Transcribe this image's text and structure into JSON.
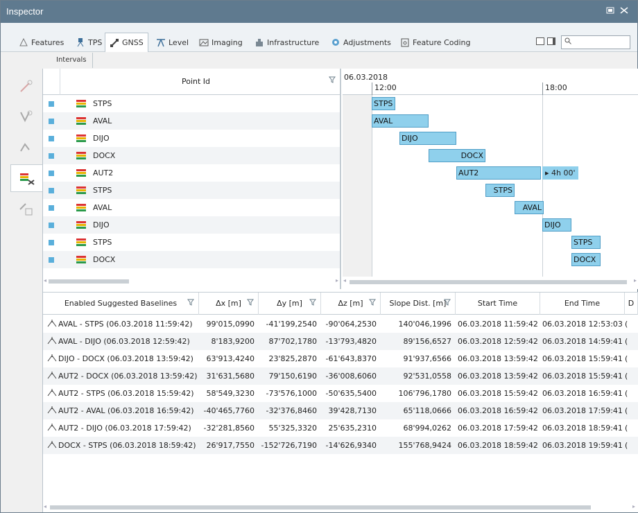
{
  "window": {
    "title": "Inspector"
  },
  "tabs": [
    {
      "label": "Features",
      "icon": "features-icon"
    },
    {
      "label": "TPS",
      "icon": "tps-icon"
    },
    {
      "label": "GNSS",
      "icon": "gnss-icon",
      "active": true
    },
    {
      "label": "Level",
      "icon": "level-icon"
    },
    {
      "label": "Imaging",
      "icon": "imaging-icon"
    },
    {
      "label": "Infrastructure",
      "icon": "infrastructure-icon"
    },
    {
      "label": "Adjustments",
      "icon": "adjustments-icon"
    },
    {
      "label": "Feature Coding",
      "icon": "feature-coding-icon"
    }
  ],
  "search": {
    "placeholder": ""
  },
  "breadcrumb": {
    "item": "Intervals"
  },
  "points": {
    "header": "Point Id",
    "rows": [
      "STPS",
      "AVAL",
      "DIJO",
      "DOCX",
      "AUT2",
      "STPS",
      "AVAL",
      "DIJO",
      "STPS",
      "DOCX"
    ]
  },
  "timeline": {
    "date": "06.03.2018",
    "ticks": [
      "12:00",
      "18:00"
    ],
    "bars": [
      {
        "label": "STPS"
      },
      {
        "label": "AVAL"
      },
      {
        "label": "DIJO"
      },
      {
        "label": "DOCX"
      },
      {
        "label": "AUT2",
        "extra": "▸  4h 00'"
      },
      {
        "label": "STPS"
      },
      {
        "label": "AVAL"
      },
      {
        "label": "DIJO"
      },
      {
        "label": "STPS"
      },
      {
        "label": "DOCX"
      }
    ]
  },
  "baselines": {
    "headers": [
      "Enabled Suggested Baselines",
      "Δx [m]",
      "Δy [m]",
      "Δz [m]",
      "Slope Dist. [m]",
      "Start Time",
      "End Time",
      "D"
    ],
    "rows": [
      [
        "AVAL - STPS (06.03.2018 11:59:42)",
        "99'015,0990",
        "-41'199,2540",
        "-90'064,2530",
        "140'046,1996",
        "06.03.2018 11:59:42",
        "06.03.2018 12:53:03",
        "("
      ],
      [
        "AVAL - DIJO (06.03.2018 12:59:42)",
        "8'183,9200",
        "87'702,1780",
        "-13'793,4820",
        "89'156,6527",
        "06.03.2018 12:59:42",
        "06.03.2018 14:59:41",
        "("
      ],
      [
        "DIJO - DOCX (06.03.2018 13:59:42)",
        "63'913,4240",
        "23'825,2870",
        "-61'643,8370",
        "91'937,6566",
        "06.03.2018 13:59:42",
        "06.03.2018 15:59:41",
        "("
      ],
      [
        "AUT2 - DOCX (06.03.2018 13:59:42)",
        "31'631,5680",
        "79'150,6190",
        "-36'008,6060",
        "92'531,0558",
        "06.03.2018 13:59:42",
        "06.03.2018 15:59:41",
        "("
      ],
      [
        "AUT2 - STPS (06.03.2018 15:59:42)",
        "58'549,3230",
        "-73'576,1000",
        "-50'635,5400",
        "106'796,1780",
        "06.03.2018 15:59:42",
        "06.03.2018 16:59:41",
        "("
      ],
      [
        "AUT2 - AVAL (06.03.2018 16:59:42)",
        "-40'465,7760",
        "-32'376,8460",
        "39'428,7130",
        "65'118,0666",
        "06.03.2018 16:59:42",
        "06.03.2018 17:59:41",
        "("
      ],
      [
        "AUT2 - DIJO (06.03.2018 17:59:42)",
        "-32'281,8560",
        "55'325,3320",
        "25'635,2310",
        "68'994,0262",
        "06.03.2018 17:59:42",
        "06.03.2018 18:59:41",
        "("
      ],
      [
        "DOCX - STPS (06.03.2018 18:59:42)",
        "26'917,7550",
        "-152'726,7190",
        "-14'626,9340",
        "155'768,9424",
        "06.03.2018 18:59:42",
        "06.03.2018 19:59:41",
        "("
      ]
    ]
  },
  "colors": {
    "titlebar": "#5f7a8f",
    "bar_fill": "#8fd0ec",
    "bar_border": "#4f9dc6",
    "point_marker": "#5aafdb"
  }
}
